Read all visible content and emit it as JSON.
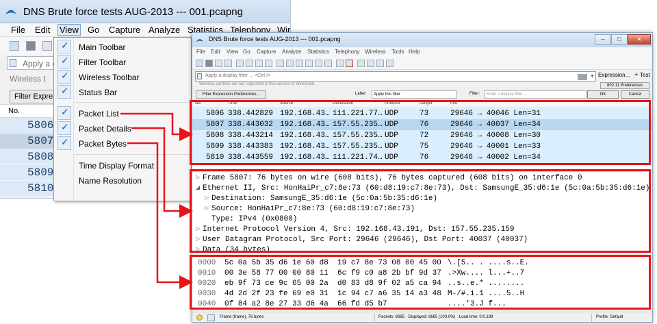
{
  "colors": {
    "highlight": "#e8141b",
    "packet_row": "#daeefd",
    "packet_row_selected": "#b8d7f1",
    "menu_check": "#2b5ea7"
  },
  "bg_window": {
    "title": "DNS Brute force tests AUG-2013 --- 001.pcapng",
    "menus": [
      "File",
      "Edit",
      "View",
      "Go",
      "Capture",
      "Analyze",
      "Statistics",
      "Telephony",
      "Wir"
    ],
    "filter_placeholder": "Apply a d",
    "wireless_text": "Wireless t",
    "filter_expr_button": "Filter Expre",
    "column_no": "No.",
    "row_numbers": [
      "5806",
      "5807",
      "5808",
      "5809",
      "5810"
    ]
  },
  "view_menu": {
    "items": [
      {
        "label": "Main Toolbar",
        "checked": true
      },
      {
        "label": "Filter Toolbar",
        "checked": true
      },
      {
        "label": "Wireless Toolbar",
        "checked": true
      },
      {
        "label": "Status Bar",
        "checked": true
      },
      {
        "label": "Packet List",
        "checked": true
      },
      {
        "label": "Packet Details",
        "checked": true
      },
      {
        "label": "Packet Bytes",
        "checked": true
      },
      {
        "label": "Time Display Format",
        "checked": false
      },
      {
        "label": "Name Resolution",
        "checked": false
      }
    ],
    "check_glyph": "✓"
  },
  "fg_window": {
    "title": "DNS Brute force tests AUG-2013 --- 001.pcapng",
    "window_controls": {
      "minimize": "–",
      "maximize": "□",
      "close": "✕"
    },
    "menus": [
      "File",
      "Edit",
      "View",
      "Go",
      "Capture",
      "Analyze",
      "Statistics",
      "Telephony",
      "Wireless",
      "Tools",
      "Help"
    ],
    "filter_placeholder": "Apply a display filter ... <Ctrl-/>",
    "expression_label": "Expression...",
    "plus": "+",
    "test_label": "Test",
    "wireless_notice": "Wireless controls are not supported in this version of Wireshark.",
    "btn_80211": "802.11 Preferences",
    "filter_expr_prefs_button": "Filter Expression Preferences...",
    "label_caption": "Label:",
    "label_value": "Apply this filter",
    "filter_caption": "Filter:",
    "filter_field_placeholder": "Enter a display filter ...",
    "ok_button": "OK",
    "cancel_button": "Cancel",
    "packet_list": {
      "columns": [
        "No.",
        "Time",
        "Source",
        "Destination",
        "Protocol",
        "Length",
        "Info"
      ],
      "rows": [
        {
          "no": "5806",
          "time": "338.442829",
          "source": "192.168.43…",
          "destination": "111.221.77…",
          "protocol": "UDP",
          "length": "73",
          "info": "29646 → 40046  Len=31",
          "selected": false
        },
        {
          "no": "5807",
          "time": "338.443032",
          "source": "192.168.43…",
          "destination": "157.55.235…",
          "protocol": "UDP",
          "length": "76",
          "info": "29646 → 40037  Len=34",
          "selected": true
        },
        {
          "no": "5808",
          "time": "338.443214",
          "source": "192.168.43…",
          "destination": "157.55.235…",
          "protocol": "UDP",
          "length": "72",
          "info": "29646 → 40008  Len=30",
          "selected": false
        },
        {
          "no": "5809",
          "time": "338.443383",
          "source": "192.168.43…",
          "destination": "157.55.235…",
          "protocol": "UDP",
          "length": "75",
          "info": "29646 → 40001  Len=33",
          "selected": false
        },
        {
          "no": "5810",
          "time": "338.443559",
          "source": "192.168.43…",
          "destination": "111.221.74…",
          "protocol": "UDP",
          "length": "76",
          "info": "29646 → 40002  Len=34",
          "selected": false
        }
      ]
    },
    "packet_details": [
      {
        "arrow": "▷",
        "indent": 0,
        "text": "Frame 5807: 76 bytes on wire (608 bits), 76 bytes captured (608 bits) on interface 0"
      },
      {
        "arrow": "◢",
        "indent": 0,
        "text": "Ethernet II, Src: HonHaiPr_c7:8e:73 (60:d8:19:c7:8e:73), Dst: SamsungE_35:d6:1e (5c:0a:5b:35:d6:1e)"
      },
      {
        "arrow": "▷",
        "indent": 1,
        "text": "Destination: SamsungE_35:d6:1e (5c:0a:5b:35:d6:1e)"
      },
      {
        "arrow": "▷",
        "indent": 1,
        "text": "Source: HonHaiPr_c7:8e:73 (60:d8:19:c7:8e:73)"
      },
      {
        "arrow": "",
        "indent": 2,
        "text": "Type: IPv4 (0x0800)"
      },
      {
        "arrow": "▷",
        "indent": 0,
        "text": "Internet Protocol Version 4, Src: 192.168.43.191, Dst: 157.55.235.159"
      },
      {
        "arrow": "▷",
        "indent": 0,
        "text": "User Datagram Protocol, Src Port: 29646 (29646), Dst Port: 40037 (40037)"
      },
      {
        "arrow": "▷",
        "indent": 0,
        "text": "Data (34 bytes)"
      }
    ],
    "packet_bytes": [
      {
        "offset": "0000",
        "hex": "5c 0a 5b 35 d6 1e 60 d8  19 c7 8e 73 08 00 45 00",
        "ascii": "\\.[5.. . ....s..E."
      },
      {
        "offset": "0010",
        "hex": "00 3e 58 77 00 00 80 11  6c f9 c0 a8 2b bf 9d 37",
        "ascii": ".>Xw.... l...+..7"
      },
      {
        "offset": "0020",
        "hex": "eb 9f 73 ce 9c 65 00 2a  d0 83 d8 9f 02 a5 ca 94",
        "ascii": "..s..e.* ........"
      },
      {
        "offset": "0030",
        "hex": "4d 2d 2f 23 fe 69 e0 31  1c 94 c7 a6 35 14 a3 48",
        "ascii": "M-/#.i.1 ....5..H"
      },
      {
        "offset": "0040",
        "hex": "0f 84 a2 8e 27 33 d6 4a  66 fd d5 b7",
        "ascii": "....'3.J f..."
      }
    ],
    "status_bar": {
      "frame": "Frame (frame), 76 bytes",
      "packets": "Packets: 8685 · Displayed: 8685 (100.0%) · Load time: 0:0.189",
      "profile": "Profile: Default"
    }
  }
}
